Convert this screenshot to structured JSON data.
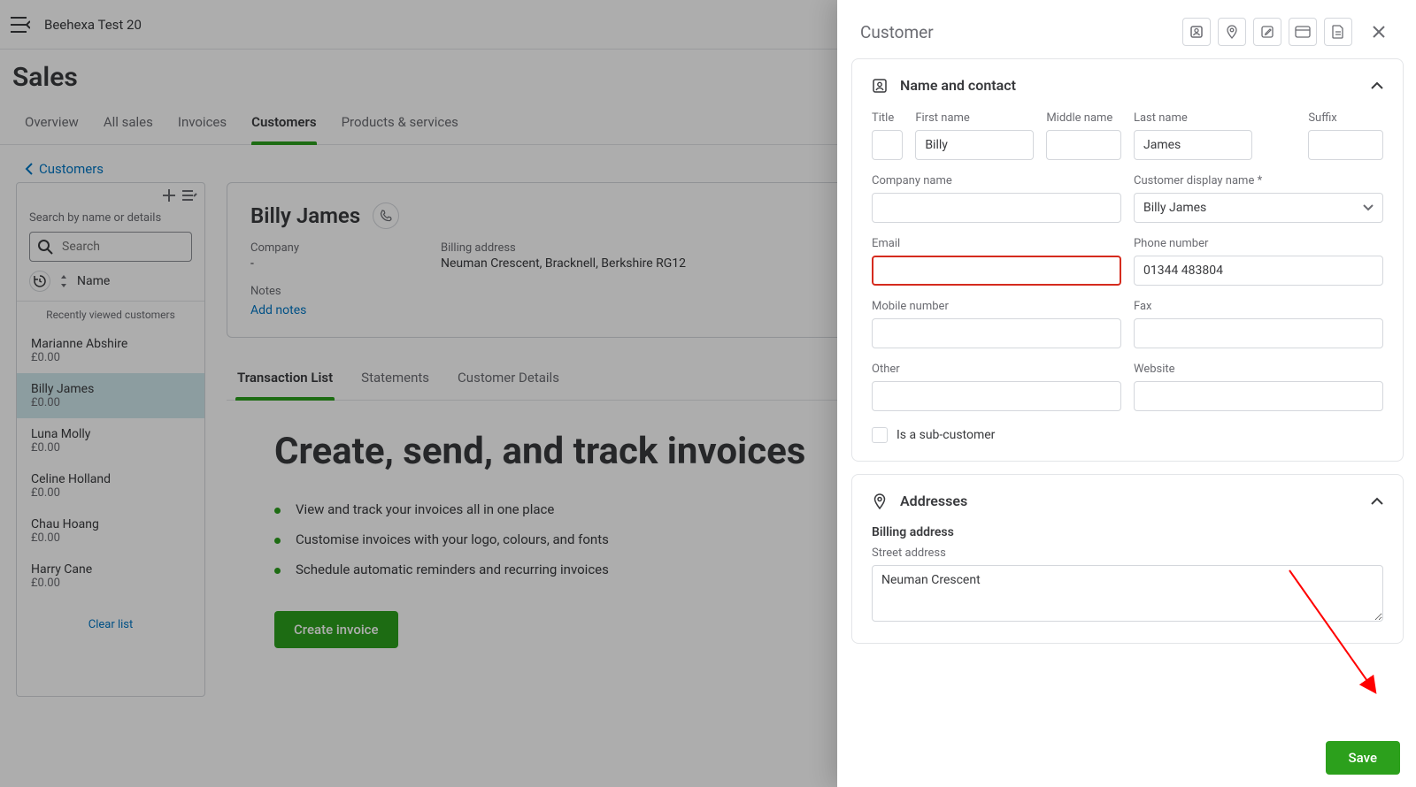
{
  "topbar": {
    "company": "Beehexa Test 20"
  },
  "page_title": "Sales",
  "tabs": [
    "Overview",
    "All sales",
    "Invoices",
    "Customers",
    "Products & services"
  ],
  "active_tab": "Customers",
  "breadcrumb": "Customers",
  "left": {
    "search_label": "Search by name or details",
    "search_placeholder": "Search",
    "sort_label": "Name",
    "recent_label": "Recently viewed customers",
    "clear": "Clear list",
    "customers": [
      {
        "name": "Marianne Abshire",
        "amount": "£0.00"
      },
      {
        "name": "Billy James",
        "amount": "£0.00",
        "selected": true
      },
      {
        "name": "Luna Molly",
        "amount": "£0.00"
      },
      {
        "name": "Celine Holland",
        "amount": "£0.00"
      },
      {
        "name": "Chau Hoang",
        "amount": "£0.00"
      },
      {
        "name": "Harry Cane",
        "amount": "£0.00"
      }
    ]
  },
  "detail": {
    "name": "Billy James",
    "company_label": "Company",
    "company_value": "-",
    "billing_label": "Billing address",
    "billing_value": "Neuman Crescent, Bracknell, Berkshire RG12",
    "notes_label": "Notes",
    "add_notes": "Add notes",
    "tabs": [
      "Transaction List",
      "Statements",
      "Customer Details"
    ],
    "active_tab": "Transaction List",
    "hero_title": "Create, send, and track invoices",
    "hero_items": [
      "View and track your invoices all in one place",
      "Customise invoices with your logo, colours, and fonts",
      "Schedule automatic reminders and recurring invoices"
    ],
    "cta": "Create invoice"
  },
  "drawer": {
    "title": "Customer",
    "sections": {
      "name_contact": "Name and contact",
      "addresses": "Addresses",
      "billing_address": "Billing address"
    },
    "labels": {
      "title": "Title",
      "first_name": "First name",
      "middle_name": "Middle name",
      "last_name": "Last name",
      "suffix": "Suffix",
      "company_name": "Company name",
      "display_name": "Customer display name *",
      "email": "Email",
      "phone": "Phone number",
      "mobile": "Mobile number",
      "fax": "Fax",
      "other": "Other",
      "website": "Website",
      "is_sub": "Is a sub-customer",
      "street": "Street address"
    },
    "values": {
      "title": "",
      "first_name": "Billy",
      "middle_name": "",
      "last_name": "James",
      "suffix": "",
      "company_name": "",
      "display_name": "Billy James",
      "email": "",
      "phone": "01344 483804",
      "mobile": "",
      "fax": "",
      "other": "",
      "website": "",
      "street": "Neuman Crescent"
    },
    "save": "Save"
  }
}
